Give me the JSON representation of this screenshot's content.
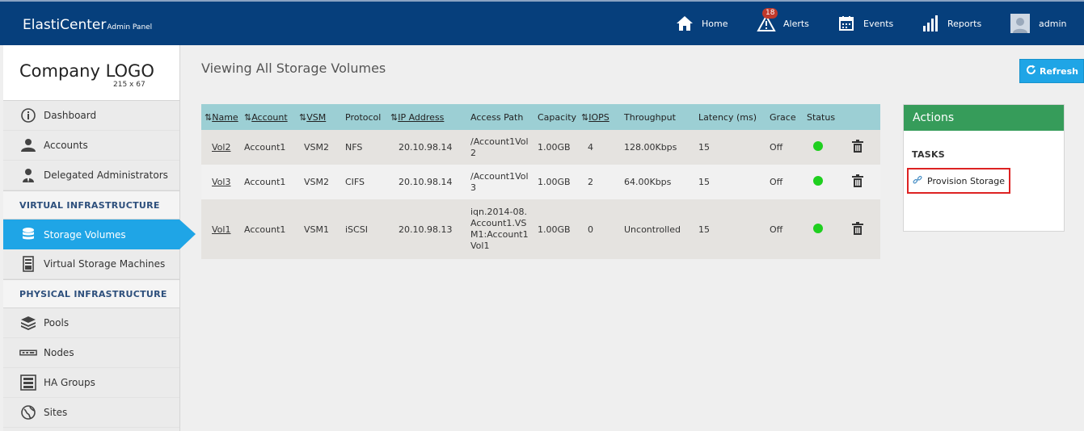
{
  "header": {
    "brand": "ElastiCenter",
    "brand_sub": "Admin Panel",
    "nav": {
      "home": "Home",
      "alerts": "Alerts",
      "alerts_count": "18",
      "events": "Events",
      "reports": "Reports",
      "user": "admin"
    }
  },
  "sidebar": {
    "logo_text": "Company LOGO",
    "logo_size": "215 x 67",
    "items": [
      {
        "label": "Dashboard"
      },
      {
        "label": "Accounts"
      },
      {
        "label": "Delegated Administrators"
      }
    ],
    "section_virtual": "VIRTUAL INFRASTRUCTURE",
    "virtual_items": [
      {
        "label": "Storage Volumes"
      },
      {
        "label": "Virtual Storage Machines"
      }
    ],
    "section_physical": "PHYSICAL INFRASTRUCTURE",
    "physical_items": [
      {
        "label": "Pools"
      },
      {
        "label": "Nodes"
      },
      {
        "label": "HA Groups"
      },
      {
        "label": "Sites"
      }
    ]
  },
  "main": {
    "title": "Viewing All Storage Volumes",
    "refresh": "Refresh",
    "columns": {
      "name": "Name",
      "account": "Account",
      "vsm": "VSM",
      "protocol": "Protocol",
      "ip": "IP Address",
      "access": "Access Path",
      "capacity": "Capacity",
      "iops": "IOPS",
      "throughput": "Throughput",
      "latency": "Latency (ms)",
      "grace": "Grace",
      "status": "Status"
    },
    "rows": [
      {
        "name": "Vol2",
        "account": "Account1",
        "vsm": "VSM2",
        "protocol": "NFS",
        "ip": "20.10.98.14",
        "access_lines": [
          "/Account1Vol",
          "2"
        ],
        "capacity": "1.00GB",
        "iops": "4",
        "throughput": "128.00Kbps",
        "latency": "15",
        "grace": "Off"
      },
      {
        "name": "Vol3",
        "account": "Account1",
        "vsm": "VSM2",
        "protocol": "CIFS",
        "ip": "20.10.98.14",
        "access_lines": [
          "/Account1Vol",
          "3"
        ],
        "capacity": "1.00GB",
        "iops": "2",
        "throughput": "64.00Kbps",
        "latency": "15",
        "grace": "Off"
      },
      {
        "name": "Vol1",
        "account": "Account1",
        "vsm": "VSM1",
        "protocol": "iSCSI",
        "ip": "20.10.98.13",
        "access_lines": [
          "iqn.2014-08.",
          "Account1.VS",
          "M1:Account1",
          "Vol1"
        ],
        "capacity": "1.00GB",
        "iops": "0",
        "throughput": "Uncontrolled",
        "latency": "15",
        "grace": "Off"
      }
    ]
  },
  "actions": {
    "title": "Actions",
    "tasks_label": "TASKS",
    "provision": "Provision Storage"
  },
  "colors": {
    "header_bg": "#063f7c",
    "accent": "#1fa5e6",
    "actions_head": "#369c5a",
    "table_head": "#9ccfd4",
    "status_ok": "#1fcf1f"
  }
}
